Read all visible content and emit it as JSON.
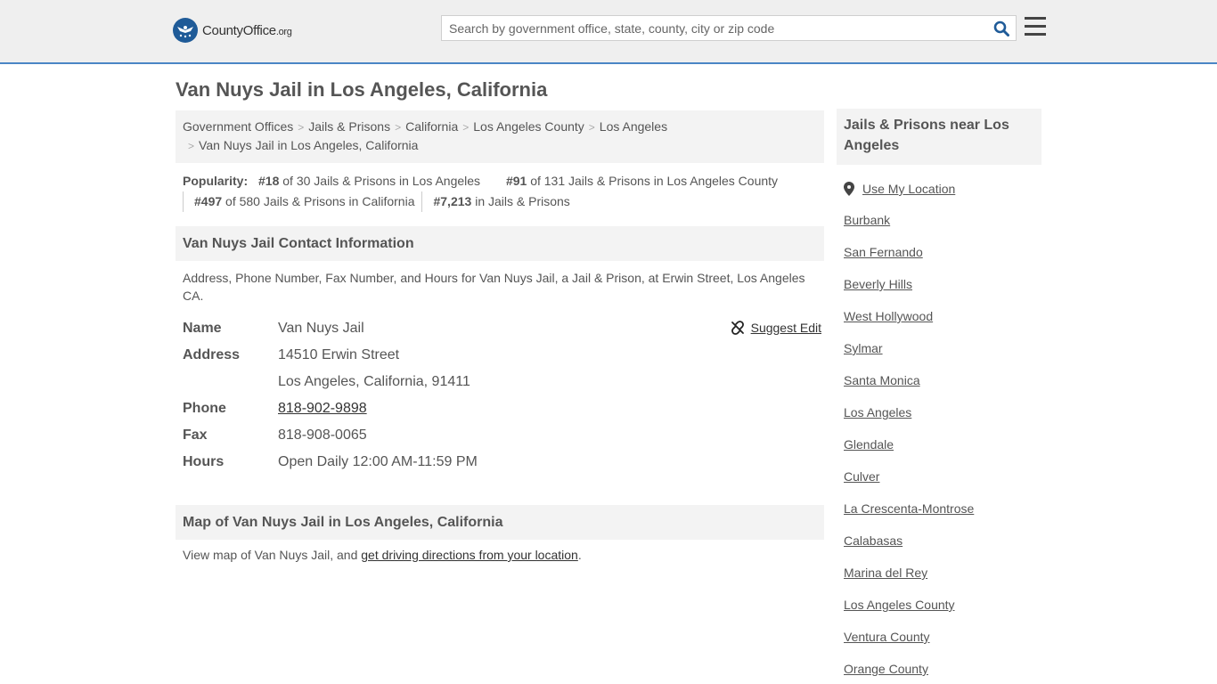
{
  "header": {
    "logo_text": "CountyOffice",
    "logo_suffix": ".org",
    "search_placeholder": "Search by government office, state, county, city or zip code"
  },
  "page_title": "Van Nuys Jail in Los Angeles, California",
  "breadcrumb": [
    "Government Offices",
    "Jails & Prisons",
    "California",
    "Los Angeles County",
    "Los Angeles",
    "Van Nuys Jail in Los Angeles, California"
  ],
  "popularity": {
    "label": "Popularity:",
    "items": [
      {
        "rank": "#18",
        "text": "of 30 Jails & Prisons in Los Angeles"
      },
      {
        "rank": "#91",
        "text": "of 131 Jails & Prisons in Los Angeles County"
      },
      {
        "rank": "#497",
        "text": "of 580 Jails & Prisons in California"
      },
      {
        "rank": "#7,213",
        "text": "in Jails & Prisons"
      }
    ]
  },
  "contact": {
    "heading": "Van Nuys Jail Contact Information",
    "intro": "Address, Phone Number, Fax Number, and Hours for Van Nuys Jail, a Jail & Prison, at Erwin Street, Los Angeles CA.",
    "suggest_edit": "Suggest Edit",
    "labels": {
      "name": "Name",
      "address": "Address",
      "phone": "Phone",
      "fax": "Fax",
      "hours": "Hours"
    },
    "name": "Van Nuys Jail",
    "address_line1": "14510 Erwin Street",
    "address_line2": "Los Angeles, California, 91411",
    "phone": "818-902-9898",
    "fax": "818-908-0065",
    "hours": "Open Daily 12:00 AM-11:59 PM"
  },
  "map": {
    "heading": "Map of Van Nuys Jail in Los Angeles, California",
    "text_before": "View map of Van Nuys Jail, and ",
    "link": "get driving directions from your location",
    "text_after": "."
  },
  "sidebar": {
    "heading": "Jails & Prisons near Los Angeles",
    "use_location": "Use My Location",
    "links": [
      "Burbank",
      "San Fernando",
      "Beverly Hills",
      "West Hollywood",
      "Sylmar",
      "Santa Monica",
      "Los Angeles",
      "Glendale",
      "Culver",
      "La Crescenta-Montrose",
      "Calabasas",
      "Marina del Rey",
      "Los Angeles County",
      "Ventura County",
      "Orange County"
    ]
  }
}
